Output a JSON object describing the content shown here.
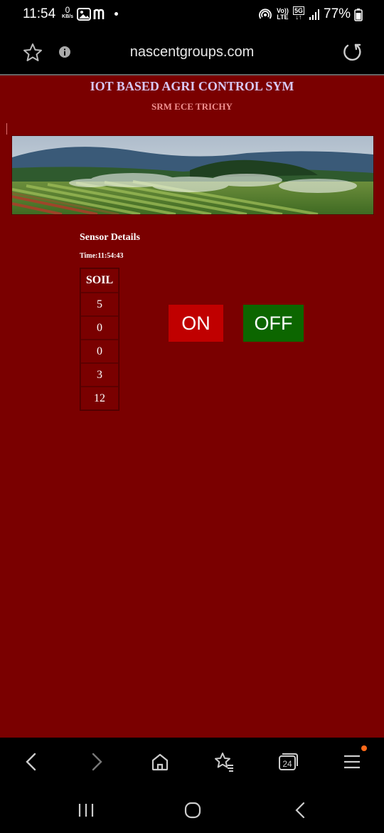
{
  "status_bar": {
    "time": "11:54",
    "net_speed_value": "0",
    "net_speed_unit": "KB/s",
    "volte_line1": "Vo))",
    "volte_line2": "LTE",
    "network_5g": "5G",
    "battery": "77%"
  },
  "browser": {
    "url": "nascentgroups.com"
  },
  "page": {
    "title": "IOT BASED AGRI CONTROL SYM",
    "subtitle": "SRM ECE TRICHY",
    "sensor_heading": "Sensor Details",
    "time_label": "Time:11:54:43",
    "table": {
      "header": "SOIL",
      "rows": [
        "5",
        "0",
        "0",
        "3",
        "12"
      ]
    },
    "on_button": "ON",
    "off_button": "OFF"
  },
  "bottom_nav": {
    "tab_count": "24"
  },
  "colors": {
    "page_background": "#7a0000",
    "on_button": "#c00000",
    "off_button": "#0c6600",
    "title": "#d8c8f5",
    "subtitle": "#f09090",
    "notification_dot": "#ff6a1a"
  }
}
